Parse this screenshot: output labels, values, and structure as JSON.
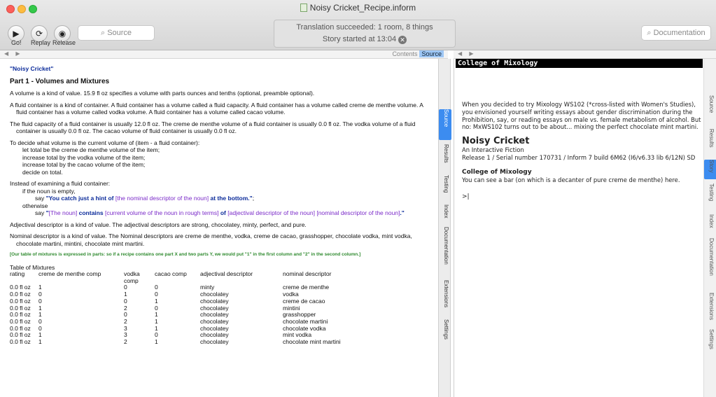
{
  "window": {
    "title": "Noisy Cricket_Recipe.inform"
  },
  "toolbar": {
    "go_label": "Go!",
    "replay_label": "Replay",
    "release_label": "Release",
    "source_search_placeholder": "Source",
    "doc_search_placeholder": "Documentation",
    "status_line1": "Translation succeeded: 1 room, 8 things",
    "status_line2": "Story started at 13:04"
  },
  "left_pane_header": {
    "tabs": [
      "Contents",
      "Source"
    ],
    "selected": "Source"
  },
  "source": {
    "title": "\"Noisy Cricket\"",
    "heading": "Part 1 - Volumes and Mixtures",
    "p1": "A volume is a kind of value. 15.9 fl oz specifies a volume with parts ounces and tenths (optional, preamble optional).",
    "p2": "A fluid container is a kind of container. A fluid container has a volume called a fluid capacity. A fluid container has a volume called creme de menthe volume. A fluid container has a volume called vodka volume. A fluid container has a volume called cacao volume.",
    "p3": "The fluid capacity of a fluid container is usually 12.0 fl oz. The creme de menthe volume of a fluid container is usually 0.0 fl oz. The vodka volume of a fluid container is usually 0.0 fl oz. The cacao volume of fluid container is usually 0.0 fl oz.",
    "rule_head": "To decide what volume is the current volume of (item - a fluid container):",
    "rule_lines": [
      "let total be the creme de menthe volume of the item;",
      "increase total by the vodka volume of the item;",
      "increase total by the cacao volume of the item;",
      "decide on total."
    ],
    "instead_head": "Instead of examining a fluid container:",
    "if_line": "if the noun is empty,",
    "say1_a": "say ",
    "say1_b": "\"You catch just a hint of ",
    "say1_c": "[the nominal descriptor of the noun]",
    "say1_d": " at the bottom.\"",
    "say1_e": ";",
    "otherwise": "otherwise",
    "say2_a": "say ",
    "say2_b": "\"",
    "say2_c": "[The noun]",
    "say2_d": " contains ",
    "say2_e": "[current volume of the noun in rough terms]",
    "say2_f": " of ",
    "say2_g": "[adjectival descriptor of the noun] [nominal descriptor of the noun]",
    "say2_h": ".\"",
    "p_adj": "Adjectival descriptor is a kind of value. The adjectival descriptors are strong, chocolatey, minty, perfect, and pure.",
    "p_nom": "Nominal descriptor is a kind of value. The Nominal descriptors are creme de menthe, vodka, creme de cacao, grasshopper, chocolate vodka, mint vodka, chocolate martini, mintini, chocolate mint martini.",
    "comment": "[Our table of mixtures is expressed in parts: so if a recipe contains one part X and two parts Y, we would put \"1\" in the first column and \"2\" in the second column.]",
    "table_title": "Table of Mixtures",
    "table_columns": [
      "rating",
      "creme de menthe comp",
      "vodka comp",
      "cacao comp",
      "adjectival descriptor",
      "nominal descriptor"
    ],
    "table_rows": [
      [
        "0.0 fl oz",
        "1",
        "0",
        "0",
        "minty",
        "creme de menthe"
      ],
      [
        "0.0 fl oz",
        "0",
        "1",
        "0",
        "chocolatey",
        "vodka"
      ],
      [
        "0.0 fl oz",
        "0",
        "0",
        "1",
        "chocolatey",
        "creme de cacao"
      ],
      [
        "0.0 fl oz",
        "1",
        "2",
        "0",
        "chocolatey",
        "mintini"
      ],
      [
        "0.0 fl oz",
        "1",
        "0",
        "1",
        "chocolatey",
        "grasshopper"
      ],
      [
        "0.0 fl oz",
        "0",
        "2",
        "1",
        "chocolatey",
        "chocolate martini"
      ],
      [
        "0.0 fl oz",
        "0",
        "3",
        "1",
        "chocolatey",
        "chocolate vodka"
      ],
      [
        "0.0 fl oz",
        "1",
        "3",
        "0",
        "chocolatey",
        "mint vodka"
      ],
      [
        "0.0 fl oz",
        "1",
        "2",
        "1",
        "chocolatey",
        "chocolate mint martini"
      ]
    ]
  },
  "left_vtabs": [
    "Source",
    "Results",
    "Testing",
    "Index",
    "Documentation",
    "Extensions",
    "Settings"
  ],
  "left_vtab_selected": "Source",
  "right_vtabs": [
    "Source",
    "Results",
    "Story",
    "Testing",
    "Index",
    "Documentation",
    "Extensions",
    "Settings"
  ],
  "right_vtab_selected": "Story",
  "story": {
    "status_bar": "College of Mixology",
    "intro": "When you decided to try Mixology WS102 (*cross-listed with Women's Studies), you envisioned yourself writing essays about gender discrimination during the Prohibition, say, or reading essays on male vs. female metabolism of alcohol. But no: MxWS102 turns out to be about... mixing the perfect chocolate mint martini.",
    "game_title": "Noisy Cricket",
    "subtitle": "An Interactive Fiction",
    "release": "Release 1 / Serial number 170731 / Inform 7 build 6M62 (I6/v6.33 lib 6/12N) SD",
    "room": "College of Mixology",
    "room_desc": "You can see a bar (on which is a decanter of pure creme de menthe) here.",
    "prompt": ">"
  },
  "colors": {
    "close": "#fc605b",
    "minimize": "#fdbc40",
    "zoom": "#34c84a",
    "tab_selected": "#3c8cf0"
  }
}
